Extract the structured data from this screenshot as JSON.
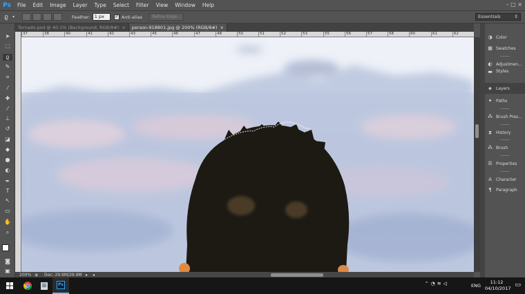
{
  "app": {
    "logo": "Ps"
  },
  "menu": [
    "File",
    "Edit",
    "Image",
    "Layer",
    "Type",
    "Select",
    "Filter",
    "View",
    "Window",
    "Help"
  ],
  "options": {
    "feather_label": "Feather:",
    "feather_value": "1 px",
    "antialias_label": "Anti-alias",
    "refine_label": "Refine Edge..."
  },
  "workspace": "Essentials",
  "tabs": [
    {
      "label": "Tornado.psd @ 40.1% (Background, RGB/8#)",
      "close": "×"
    },
    {
      "label": "person-918801.jpg @ 200% (RGB/8#)",
      "close": "×"
    }
  ],
  "ruler_labels": [
    "37",
    "38",
    "40",
    "41",
    "42",
    "43",
    "45",
    "46",
    "47",
    "48",
    "50",
    "51",
    "52",
    "53",
    "55",
    "56",
    "57",
    "58",
    "60",
    "61",
    "62"
  ],
  "status": {
    "zoom": "200%",
    "doc": "Doc: 29.9M/29.9M"
  },
  "panels": [
    {
      "label": "Color",
      "icon": "color-wheel-icon"
    },
    {
      "label": "Swatches",
      "icon": "swatches-grid-icon"
    },
    {
      "label": "Adjustmen...",
      "icon": "adjustments-icon"
    },
    {
      "label": "Styles",
      "icon": "styles-icon"
    },
    {
      "label": "Layers",
      "icon": "layers-icon"
    },
    {
      "label": "Paths",
      "icon": "paths-icon"
    },
    {
      "label": "Brush Pres...",
      "icon": "brush-presets-icon"
    },
    {
      "label": "History",
      "icon": "history-icon"
    },
    {
      "label": "Brush",
      "icon": "brush-icon"
    },
    {
      "label": "Properties",
      "icon": "properties-icon"
    },
    {
      "label": "Character",
      "icon": "character-icon"
    },
    {
      "label": "Paragraph",
      "icon": "paragraph-icon"
    }
  ],
  "taskbar": {
    "lang": "ENG",
    "time": "11:12",
    "date": "04/10/2017"
  },
  "colors": {
    "ps_blue": "#31a8ff",
    "ui_gray": "#535353",
    "taskbar": "#161616"
  }
}
